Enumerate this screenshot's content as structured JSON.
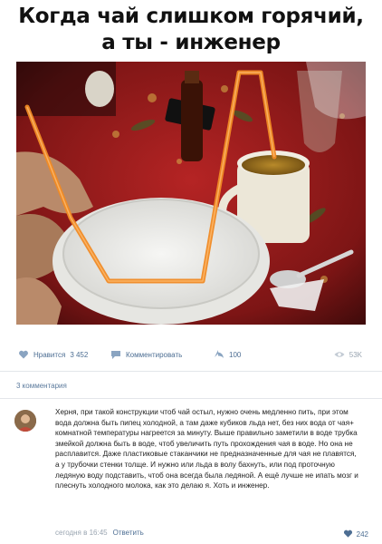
{
  "meme": {
    "title_line1": "Когда чай слишком горячий,",
    "title_line2": "а ты - инженер"
  },
  "actions": {
    "like_label": "Нравится",
    "like_count": "3 452",
    "comment_label": "Комментировать",
    "share_count": "100",
    "views_count": "53K"
  },
  "comments": {
    "count_label": "3 комментария",
    "items": [
      {
        "text": "Херня, при такой конструкции чтоб чай остыл, нужно очень медленно пить, при этом вода должна быть пипец холодной, а там даже кубиков льда нет, без них вода от чая+ комнатной температуры нагреется за минуту. Выше правильно заметили в воде трубка змейкой должна быть в воде, чтоб увеличить путь прохождения чая в воде. Но она не расплавится. Даже пластиковые стаканчики не предназначенные для чая не плавятся, а у трубочки стенки толще. И нужно или льда в волу бахнуть, или под проточную ледяную воду подставить, чтоб она всегда была ледяной. А ещё лучше не ипать мозг и плеснуть холодного молока, как это делаю я. Хоть и инженер.",
        "time": "сегодня в 16:45",
        "reply_label": "Ответить",
        "likes": "242"
      }
    ]
  },
  "colors": {
    "link": "#4d6e93",
    "muted": "#9aa5b1",
    "tablecloth": "#9b1c1c",
    "straw": "#f08a24"
  }
}
